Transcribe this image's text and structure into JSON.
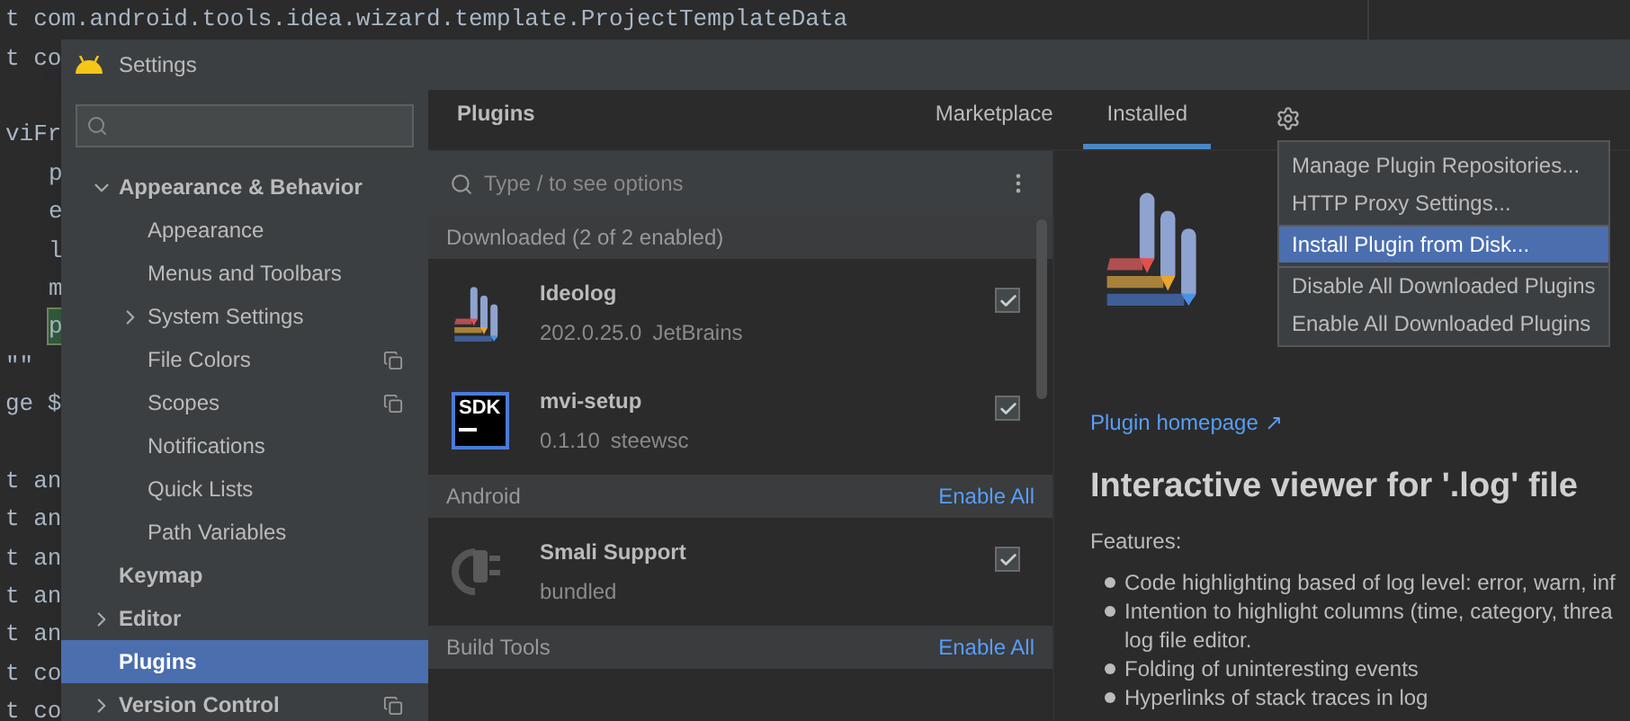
{
  "editor": {
    "lines": [
      {
        "kind": "code",
        "text": "t com.android.tools.idea.wizard.template.ProjectTemplateData",
        "highlighted": false
      },
      {
        "kind": "code",
        "text": "t co",
        "highlighted": false
      },
      {
        "kind": "blank"
      },
      {
        "kind": "code",
        "text": "viFr",
        "highlighted": false
      },
      {
        "kind": "indented",
        "text": "p",
        "highlighted": false
      },
      {
        "kind": "indented",
        "text": "e",
        "highlighted": false
      },
      {
        "kind": "indented",
        "text": "l",
        "highlighted": false
      },
      {
        "kind": "indented",
        "text": "m",
        "highlighted": false
      },
      {
        "kind": "indented",
        "text": "p",
        "highlighted": true
      },
      {
        "kind": "code",
        "text": "\"\"",
        "highlighted": false
      },
      {
        "kind": "code",
        "text": "ge $",
        "highlighted": false
      },
      {
        "kind": "blank"
      },
      {
        "kind": "code",
        "text": "t an",
        "highlighted": false
      },
      {
        "kind": "code",
        "text": "t an",
        "highlighted": false
      },
      {
        "kind": "code",
        "text": "t an",
        "highlighted": false
      },
      {
        "kind": "code",
        "text": "t an",
        "highlighted": false
      },
      {
        "kind": "code",
        "text": "t an",
        "highlighted": false
      },
      {
        "kind": "code",
        "text": "t co",
        "highlighted": false
      },
      {
        "kind": "code",
        "text": "t co",
        "highlighted": false
      }
    ]
  },
  "dialog": {
    "title": "Settings"
  },
  "sidebar": {
    "items": [
      {
        "label": "Appearance & Behavior",
        "expanded": true,
        "selected": false,
        "shared": false,
        "children": [
          {
            "label": "Appearance",
            "selected": false,
            "shared": false
          },
          {
            "label": "Menus and Toolbars",
            "selected": false,
            "shared": false
          },
          {
            "label": "System Settings",
            "expanded": false,
            "selected": false,
            "shared": false
          },
          {
            "label": "File Colors",
            "selected": false,
            "shared": true
          },
          {
            "label": "Scopes",
            "selected": false,
            "shared": true
          },
          {
            "label": "Notifications",
            "selected": false,
            "shared": false
          },
          {
            "label": "Quick Lists",
            "selected": false,
            "shared": false
          },
          {
            "label": "Path Variables",
            "selected": false,
            "shared": false
          }
        ]
      },
      {
        "label": "Keymap",
        "selected": false,
        "shared": false
      },
      {
        "label": "Editor",
        "expanded": false,
        "selected": false,
        "shared": false
      },
      {
        "label": "Plugins",
        "selected": true,
        "shared": false
      },
      {
        "label": "Version Control",
        "expanded": false,
        "selected": false,
        "shared": true
      }
    ]
  },
  "plugins": {
    "title": "Plugins",
    "tabs": [
      {
        "label": "Marketplace",
        "selected": false
      },
      {
        "label": "Installed",
        "selected": true
      }
    ],
    "search": {
      "placeholder": "Type / to see options"
    },
    "groups": [
      {
        "title": "Downloaded (2 of 2 enabled)",
        "plugins": [
          {
            "name": "Ideolog",
            "version": "202.0.25.0",
            "vendor": "JetBrains",
            "checked": true,
            "kind": "ideolog"
          },
          {
            "name": "mvi-setup",
            "version": "0.1.10",
            "vendor": "steewsc",
            "checked": true,
            "kind": "sdk",
            "icon_text": "SDK"
          }
        ]
      },
      {
        "title": "Android",
        "action": "Enable All",
        "plugins": [
          {
            "name": "Smali Support",
            "version": "bundled",
            "checked": true,
            "kind": "plug"
          }
        ]
      },
      {
        "title": "Build Tools",
        "action": "Enable All"
      }
    ]
  },
  "menu": {
    "items": [
      {
        "label": "Manage Plugin Repositories...",
        "selected": false,
        "separator_before": false
      },
      {
        "label": "HTTP Proxy Settings...",
        "selected": false,
        "separator_before": false
      },
      {
        "label": "Install Plugin from Disk...",
        "selected": true,
        "separator_before": true
      },
      {
        "label": "Disable All Downloaded Plugins",
        "selected": false,
        "separator_before": true
      },
      {
        "label": "Enable All Downloaded Plugins",
        "selected": false,
        "separator_before": false
      }
    ]
  },
  "detail": {
    "link": "Plugin homepage",
    "link_mark": "↗",
    "heading": "Interactive viewer for '.log' file",
    "features_label": "Features:",
    "bullets": [
      {
        "lines": [
          "Code highlighting based of log level: error, warn, inf"
        ]
      },
      {
        "lines": [
          "Intention to highlight columns (time, category, threa",
          "log file editor."
        ]
      },
      {
        "lines": [
          "Folding of uninteresting events"
        ]
      },
      {
        "lines": [
          "Hyperlinks of stack traces in log"
        ]
      }
    ]
  }
}
